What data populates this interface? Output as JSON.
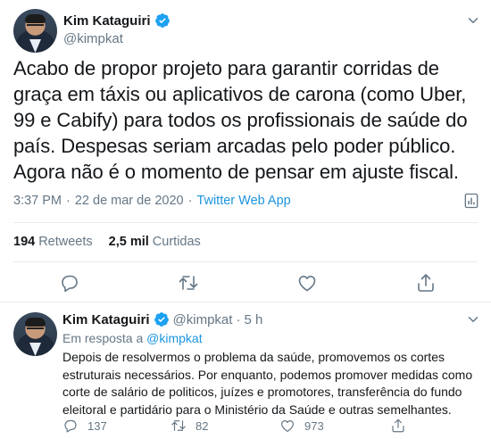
{
  "main_tweet": {
    "author_name": "Kim Kataguiri",
    "author_handle": "@kimpkat",
    "text": "Acabo de propor projeto para garantir corridas de graça em táxis ou aplicativos de carona (como Uber, 99 e Cabify) para todos os profissionais de saúde do país. Despesas seriam arcadas pelo poder público. Agora não é o momento de pensar em ajuste fiscal.",
    "time": "3:37 PM",
    "separator": "·",
    "date": "22 de mar de 2020",
    "source": "Twitter Web App",
    "retweets_count": "194",
    "retweets_label": "Retweets",
    "likes_count": "2,5 mil",
    "likes_label": "Curtidas"
  },
  "reply_tweet": {
    "author_name": "Kim Kataguiri",
    "author_handle": "@kimpkat",
    "separator": "·",
    "time_ago": "5 h",
    "context_prefix": "Em resposta a",
    "context_mention": "@kimpkat",
    "text": "Depois de resolvermos o problema da saúde, promovemos os cortes estruturais necessários. Por enquanto, podemos promover medidas como corte de salário de politicos, juízes e promotores, transferência do fundo eleitoral e partidário para o Ministério da Saúde e outras semelhantes.",
    "reply_count": "137",
    "retweet_count": "82",
    "like_count": "973"
  },
  "colors": {
    "accent": "#1b95e0",
    "secondary_text": "#657786",
    "primary_text": "#14171a",
    "divider": "#e6ecf0",
    "verified": "#1da1f2"
  },
  "icons": [
    "verified-badge-icon",
    "chevron-down-icon",
    "analytics-icon",
    "reply-icon",
    "retweet-icon",
    "like-icon",
    "share-icon"
  ]
}
